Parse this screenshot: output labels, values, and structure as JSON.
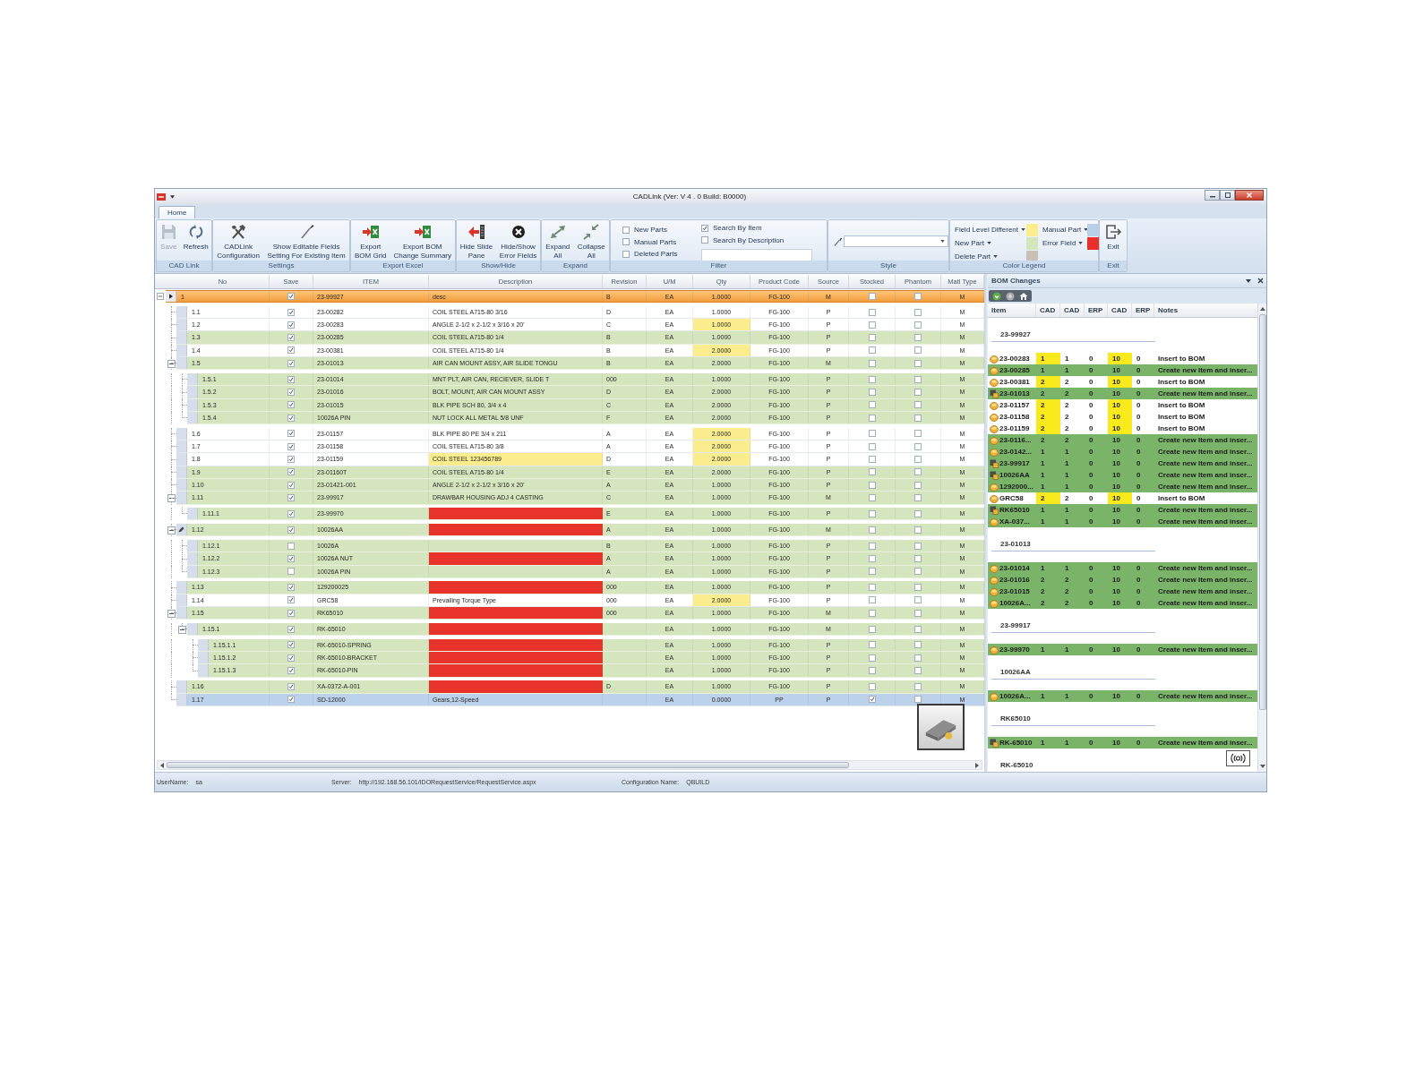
{
  "window": {
    "title": "CADLink (Ver: V 4 . 0 Build: B0000)"
  },
  "ribbon": {
    "tabs": [
      {
        "label": "Home",
        "selected": true
      }
    ],
    "groups": [
      {
        "kind": "buttons",
        "label": "CAD Link",
        "buttons": [
          {
            "label": "Save",
            "disabled": true
          },
          {
            "label": "Refresh",
            "disabled": false
          }
        ]
      },
      {
        "kind": "buttons",
        "label": "Settings",
        "buttons": [
          {
            "label": "CADLink\nConfiguration",
            "disabled": false
          },
          {
            "label": "Show Editable Fields\nSetting For Existing Item",
            "disabled": false
          }
        ]
      },
      {
        "kind": "buttons",
        "label": "Export Excel",
        "buttons": [
          {
            "label": "Export\nBOM Grid",
            "disabled": false
          },
          {
            "label": "Export BOM\nChange Summary",
            "disabled": false
          }
        ]
      },
      {
        "kind": "buttons",
        "label": "Show/Hide",
        "buttons": [
          {
            "label": "Hide Slide\nPane",
            "disabled": false
          },
          {
            "label": "Hide/Show\nError Fields",
            "disabled": false
          }
        ]
      },
      {
        "kind": "buttons",
        "label": "Expand",
        "buttons": [
          {
            "label": "Expand\nAll",
            "disabled": false
          },
          {
            "label": "Collapse\nAll",
            "disabled": false
          }
        ]
      },
      {
        "kind": "filter",
        "label": "Filter",
        "part_filters": [
          {
            "label": "New Parts",
            "checked": false
          },
          {
            "label": "Manual Parts",
            "checked": false
          },
          {
            "label": "Deleted Parts",
            "checked": false
          }
        ],
        "search_modes": [
          {
            "label": "Search By Item",
            "checked": true
          },
          {
            "label": "Search By Description",
            "checked": false
          }
        ]
      },
      {
        "kind": "style",
        "label": "Style"
      },
      {
        "kind": "legend",
        "label": "Color Legend",
        "items": [
          {
            "label": "Field Level Different",
            "color": "#fcee8e"
          },
          {
            "label": "New Part",
            "color": "#d4e6bc"
          },
          {
            "label": "Delete Part",
            "color": "#c8c0b7"
          },
          {
            "label": "Manual Part",
            "color": "#b8cfe7"
          },
          {
            "label": "Error Field",
            "color": "#e8302a"
          }
        ]
      },
      {
        "kind": "buttons",
        "label": "Exit",
        "buttons": [
          {
            "label": "Exit",
            "disabled": false
          }
        ]
      }
    ]
  },
  "grid": {
    "columns": [
      "No",
      "Save",
      "ITEM",
      "Description",
      "Revision",
      "U/M",
      "Qty",
      "Product Code",
      "Source",
      "Stocked",
      "Phantom",
      "Matl Type"
    ],
    "rows": [
      {
        "no": "1",
        "save": true,
        "item": "23-99927",
        "description": "desc",
        "revision": "B",
        "um": "EA",
        "qty": "1.0000",
        "product_code": "FG-100",
        "source": "M",
        "stocked": false,
        "phantom": false,
        "matl_type": "M",
        "selected": true,
        "editing": false,
        "qty_changed": false,
        "description_changed": false,
        "description_error": false,
        "expanded": true,
        "children": [
          {
            "no": "1.1",
            "save": true,
            "item": "23-00282",
            "description": "COIL STEEL A715-80 3/16",
            "revision": "D",
            "um": "EA",
            "qty": "1.0000",
            "product_code": "FG-100",
            "source": "P",
            "stocked": false,
            "phantom": false,
            "matl_type": "M",
            "kind": "existing",
            "selected": false,
            "editing": false,
            "qty_changed": false,
            "description_changed": false,
            "description_error": false
          },
          {
            "no": "1.2",
            "save": true,
            "item": "23-00283",
            "description": "ANGLE 2-1/2 x 2-1/2 x 3/16 x 20'",
            "revision": "C",
            "um": "EA",
            "qty": "1.0000",
            "product_code": "FG-100",
            "source": "P",
            "stocked": false,
            "phantom": false,
            "matl_type": "M",
            "kind": "existing",
            "selected": false,
            "editing": false,
            "qty_changed": true,
            "description_changed": false,
            "description_error": false
          },
          {
            "no": "1.3",
            "save": true,
            "item": "23-00285",
            "description": "COIL STEEL A715-80 1/4",
            "revision": "B",
            "um": "EA",
            "qty": "1.0000",
            "product_code": "FG-100",
            "source": "P",
            "stocked": false,
            "phantom": false,
            "matl_type": "M",
            "kind": "new",
            "selected": false,
            "editing": false,
            "qty_changed": false,
            "description_changed": false,
            "description_error": false
          },
          {
            "no": "1.4",
            "save": true,
            "item": "23-00381",
            "description": "COIL STEEL A715-80 1/4",
            "revision": "B",
            "um": "EA",
            "qty": "2.0000",
            "product_code": "FG-100",
            "source": "P",
            "stocked": false,
            "phantom": false,
            "matl_type": "M",
            "kind": "existing",
            "selected": false,
            "editing": false,
            "qty_changed": true,
            "description_changed": false,
            "description_error": false
          },
          {
            "no": "1.5",
            "save": true,
            "item": "23-01013",
            "description": "AIR CAN MOUNT ASSY, AIR SLIDE TONGU",
            "revision": "B",
            "um": "EA",
            "qty": "2.0000",
            "product_code": "FG-100",
            "source": "M",
            "stocked": false,
            "phantom": false,
            "matl_type": "M",
            "kind": "new",
            "selected": false,
            "editing": false,
            "qty_changed": false,
            "description_changed": false,
            "description_error": false,
            "expanded": true,
            "children": [
              {
                "no": "1.5.1",
                "save": true,
                "item": "23-01014",
                "description": "MNT PLT, AIR CAN, RECIEVER, SLIDE T",
                "revision": "000",
                "um": "EA",
                "qty": "1.0000",
                "product_code": "FG-100",
                "source": "P",
                "stocked": false,
                "phantom": false,
                "matl_type": "M",
                "kind": "new",
                "selected": false,
                "editing": false,
                "qty_changed": false,
                "description_changed": false,
                "description_error": false
              },
              {
                "no": "1.5.2",
                "save": true,
                "item": "23-01016",
                "description": "BOLT, MOUNT, AIR CAN MOUNT ASSY",
                "revision": "D",
                "um": "EA",
                "qty": "2.0000",
                "product_code": "FG-100",
                "source": "P",
                "stocked": false,
                "phantom": false,
                "matl_type": "M",
                "kind": "new",
                "selected": false,
                "editing": false,
                "qty_changed": false,
                "description_changed": false,
                "description_error": false
              },
              {
                "no": "1.5.3",
                "save": true,
                "item": "23-01015",
                "description": "BLK PIPE SCH 80, 3/4 x 4",
                "revision": "C",
                "um": "EA",
                "qty": "2.0000",
                "product_code": "FG-100",
                "source": "P",
                "stocked": false,
                "phantom": false,
                "matl_type": "M",
                "kind": "new",
                "selected": false,
                "editing": false,
                "qty_changed": false,
                "description_changed": false,
                "description_error": false
              },
              {
                "no": "1.5.4",
                "save": true,
                "item": "10026A PIN",
                "description": "NUT LOCK ALL METAL 5/8 UNF",
                "revision": "F",
                "um": "EA",
                "qty": "2.0000",
                "product_code": "FG-100",
                "source": "P",
                "stocked": false,
                "phantom": false,
                "matl_type": "M",
                "kind": "new",
                "selected": false,
                "editing": false,
                "qty_changed": false,
                "description_changed": false,
                "description_error": false
              }
            ]
          },
          {
            "no": "1.6",
            "save": true,
            "item": "23-01157",
            "description": "BLK PIPE 80 PE 3/4 x 211",
            "revision": "A",
            "um": "EA",
            "qty": "2.0000",
            "product_code": "FG-100",
            "source": "P",
            "stocked": false,
            "phantom": false,
            "matl_type": "M",
            "kind": "existing",
            "selected": false,
            "editing": false,
            "qty_changed": true,
            "description_changed": false,
            "description_error": false
          },
          {
            "no": "1.7",
            "save": true,
            "item": "23-01158",
            "description": "COIL STEEL A715-80 3/8",
            "revision": "A",
            "um": "EA",
            "qty": "2.0000",
            "product_code": "FG-100",
            "source": "P",
            "stocked": false,
            "phantom": false,
            "matl_type": "M",
            "kind": "existing",
            "selected": false,
            "editing": false,
            "qty_changed": true,
            "description_changed": false,
            "description_error": false
          },
          {
            "no": "1.8",
            "save": true,
            "item": "23-01159",
            "description": "COIL STEEL 123456789",
            "revision": "D",
            "um": "EA",
            "qty": "2.0000",
            "product_code": "FG-100",
            "source": "P",
            "stocked": false,
            "phantom": false,
            "matl_type": "M",
            "kind": "existing",
            "selected": false,
            "editing": false,
            "qty_changed": true,
            "description_changed": true,
            "description_error": false
          },
          {
            "no": "1.9",
            "save": true,
            "item": "23-01160T",
            "description": "COIL STEEL A715-80 1/4",
            "revision": "E",
            "um": "EA",
            "qty": "2.0000",
            "product_code": "FG-100",
            "source": "P",
            "stocked": false,
            "phantom": false,
            "matl_type": "M",
            "kind": "new",
            "selected": false,
            "editing": false,
            "qty_changed": false,
            "description_changed": false,
            "description_error": false
          },
          {
            "no": "1.10",
            "save": true,
            "item": "23-01421-001",
            "description": "ANGLE 2-1/2 x 2-1/2 x 3/16 x 20'",
            "revision": "A",
            "um": "EA",
            "qty": "1.0000",
            "product_code": "FG-100",
            "source": "P",
            "stocked": false,
            "phantom": false,
            "matl_type": "M",
            "kind": "new",
            "selected": false,
            "editing": false,
            "qty_changed": false,
            "description_changed": false,
            "description_error": false
          },
          {
            "no": "1.11",
            "save": true,
            "item": "23-99917",
            "description": "DRAWBAR HOUSING ADJ 4 CASTING",
            "revision": "C",
            "um": "EA",
            "qty": "1.0000",
            "product_code": "FG-100",
            "source": "M",
            "stocked": false,
            "phantom": false,
            "matl_type": "M",
            "kind": "new",
            "selected": false,
            "editing": false,
            "qty_changed": false,
            "description_changed": false,
            "description_error": false,
            "expanded": true,
            "children": [
              {
                "no": "1.11.1",
                "save": true,
                "item": "23-99970",
                "revision": "E",
                "um": "EA",
                "qty": "1.0000",
                "product_code": "FG-100",
                "source": "P",
                "stocked": false,
                "phantom": false,
                "matl_type": "M",
                "kind": "new",
                "selected": false,
                "editing": false,
                "qty_changed": false,
                "description_changed": false,
                "description_error": true
              }
            ]
          },
          {
            "no": "1.12",
            "save": true,
            "item": "10026AA",
            "revision": "A",
            "um": "EA",
            "qty": "1.0000",
            "product_code": "FG-100",
            "source": "M",
            "stocked": false,
            "phantom": false,
            "matl_type": "M",
            "kind": "new",
            "selected": false,
            "editing": true,
            "qty_changed": false,
            "description_changed": false,
            "description_error": true,
            "expanded": true,
            "children": [
              {
                "no": "1.12.1",
                "save": false,
                "item": "10026A",
                "revision": "B",
                "um": "EA",
                "qty": "1.0000",
                "product_code": "FG-100",
                "source": "P",
                "stocked": false,
                "phantom": false,
                "matl_type": "M",
                "kind": "new",
                "selected": false,
                "editing": false,
                "qty_changed": false,
                "description_changed": false,
                "description_error": false
              },
              {
                "no": "1.12.2",
                "save": true,
                "item": "10026A NUT",
                "revision": "A",
                "um": "EA",
                "qty": "1.0000",
                "product_code": "FG-100",
                "source": "P",
                "stocked": false,
                "phantom": false,
                "matl_type": "M",
                "kind": "new",
                "selected": false,
                "editing": false,
                "qty_changed": false,
                "description_changed": false,
                "description_error": true
              },
              {
                "no": "1.12.3",
                "save": false,
                "item": "10026A PIN",
                "revision": "A",
                "um": "EA",
                "qty": "1.0000",
                "product_code": "FG-100",
                "source": "P",
                "stocked": false,
                "phantom": false,
                "matl_type": "M",
                "kind": "new",
                "selected": false,
                "editing": false,
                "qty_changed": false,
                "description_changed": false,
                "description_error": false
              }
            ]
          },
          {
            "no": "1.13",
            "save": true,
            "item": "129200025",
            "revision": "000",
            "um": "EA",
            "qty": "1.0000",
            "product_code": "FG-100",
            "source": "P",
            "stocked": false,
            "phantom": false,
            "matl_type": "M",
            "kind": "new",
            "selected": false,
            "editing": false,
            "qty_changed": false,
            "description_changed": false,
            "description_error": true
          },
          {
            "no": "1.14",
            "save": true,
            "item": "GRC58",
            "description": "Prevailing Torque Type",
            "revision": "000",
            "um": "EA",
            "qty": "2.0000",
            "product_code": "FG-100",
            "source": "P",
            "stocked": false,
            "phantom": false,
            "matl_type": "M",
            "kind": "existing",
            "selected": false,
            "editing": false,
            "qty_changed": true,
            "description_changed": false,
            "description_error": false
          },
          {
            "no": "1.15",
            "save": true,
            "item": "RK65010",
            "revision": "000",
            "um": "EA",
            "qty": "1.0000",
            "product_code": "FG-100",
            "source": "M",
            "stocked": false,
            "phantom": false,
            "matl_type": "M",
            "kind": "new",
            "selected": false,
            "editing": false,
            "qty_changed": false,
            "description_changed": false,
            "description_error": true,
            "expanded": true,
            "children": [
              {
                "no": "1.15.1",
                "save": true,
                "item": "RK-65010",
                "um": "EA",
                "qty": "1.0000",
                "product_code": "FG-100",
                "source": "M",
                "stocked": false,
                "phantom": false,
                "matl_type": "M",
                "kind": "new",
                "selected": false,
                "editing": false,
                "qty_changed": false,
                "description_changed": false,
                "description_error": true,
                "expanded": true,
                "children": [
                  {
                    "no": "1.15.1.1",
                    "save": true,
                    "item": "RK-65010-SPRING",
                    "um": "EA",
                    "qty": "1.0000",
                    "product_code": "FG-100",
                    "source": "P",
                    "stocked": false,
                    "phantom": false,
                    "matl_type": "M",
                    "kind": "new",
                    "selected": false,
                    "editing": false,
                    "qty_changed": false,
                    "description_changed": false,
                    "description_error": true
                  },
                  {
                    "no": "1.15.1.2",
                    "save": true,
                    "item": "RK-65010-BRACKET",
                    "um": "EA",
                    "qty": "1.0000",
                    "product_code": "FG-100",
                    "source": "P",
                    "stocked": false,
                    "phantom": false,
                    "matl_type": "M",
                    "kind": "new",
                    "selected": false,
                    "editing": false,
                    "qty_changed": false,
                    "description_changed": false,
                    "description_error": true
                  },
                  {
                    "no": "1.15.1.3",
                    "save": true,
                    "item": "RK-65010-PIN",
                    "um": "EA",
                    "qty": "1.0000",
                    "product_code": "FG-100",
                    "source": "P",
                    "stocked": false,
                    "phantom": false,
                    "matl_type": "M",
                    "kind": "new",
                    "selected": false,
                    "editing": false,
                    "qty_changed": false,
                    "description_changed": false,
                    "description_error": true
                  }
                ]
              }
            ]
          },
          {
            "no": "1.16",
            "save": true,
            "item": "XA-0372-A-001",
            "revision": "D",
            "um": "EA",
            "qty": "1.0000",
            "product_code": "FG-100",
            "source": "P",
            "stocked": false,
            "phantom": false,
            "matl_type": "M",
            "kind": "new",
            "selected": false,
            "editing": false,
            "qty_changed": false,
            "description_changed": false,
            "description_error": true
          },
          {
            "no": "1.17",
            "save": true,
            "item": "SD-12000",
            "description": "Gears,12-Speed",
            "um": "EA",
            "qty": "0.0000",
            "product_code": "PP",
            "source": "P",
            "stocked": true,
            "phantom": false,
            "matl_type": "M",
            "kind": "manual",
            "selected": false,
            "editing": false,
            "qty_changed": false,
            "description_changed": false,
            "description_error": false
          }
        ]
      }
    ]
  },
  "bom_changes": {
    "title": "BOM Changes",
    "columns": [
      "Item",
      "CAD",
      "CAD",
      "ERP",
      "CAD",
      "ERP",
      "Notes"
    ],
    "groups": [
      {
        "title": "23-99927",
        "rows": [
          {
            "item": "23-00283",
            "kind": "part",
            "quantities": [
              "1",
              "1",
              "0",
              "10",
              "0"
            ],
            "notes": "Insert to BOM",
            "new_item": false,
            "changed": true
          },
          {
            "item": "23-00285",
            "kind": "part",
            "quantities": [
              "1",
              "1",
              "0",
              "10",
              "0"
            ],
            "notes": "Create new Item and inser...",
            "new_item": true,
            "changed": false
          },
          {
            "item": "23-00381",
            "kind": "part",
            "quantities": [
              "2",
              "2",
              "0",
              "10",
              "0"
            ],
            "notes": "Insert to BOM",
            "new_item": false,
            "changed": true
          },
          {
            "item": "23-01013",
            "kind": "assembly",
            "quantities": [
              "2",
              "2",
              "0",
              "10",
              "0"
            ],
            "notes": "Create new Item and inser...",
            "new_item": true,
            "changed": false
          },
          {
            "item": "23-01157",
            "kind": "part",
            "quantities": [
              "2",
              "2",
              "0",
              "10",
              "0"
            ],
            "notes": "Insert to BOM",
            "new_item": false,
            "changed": true
          },
          {
            "item": "23-01158",
            "kind": "part",
            "quantities": [
              "2",
              "2",
              "0",
              "10",
              "0"
            ],
            "notes": "Insert to BOM",
            "new_item": false,
            "changed": true
          },
          {
            "item": "23-01159",
            "kind": "part",
            "quantities": [
              "2",
              "2",
              "0",
              "10",
              "0"
            ],
            "notes": "Insert to BOM",
            "new_item": false,
            "changed": true
          },
          {
            "item": "23-0116...",
            "kind": "part",
            "quantities": [
              "2",
              "2",
              "0",
              "10",
              "0"
            ],
            "notes": "Create new Item and inser...",
            "new_item": true,
            "changed": false
          },
          {
            "item": "23-0142...",
            "kind": "part",
            "quantities": [
              "1",
              "1",
              "0",
              "10",
              "0"
            ],
            "notes": "Create new Item and inser...",
            "new_item": true,
            "changed": false
          },
          {
            "item": "23-99917",
            "kind": "assembly",
            "quantities": [
              "1",
              "1",
              "0",
              "10",
              "0"
            ],
            "notes": "Create new Item and inser...",
            "new_item": true,
            "changed": false
          },
          {
            "item": "10026AA",
            "kind": "assembly",
            "quantities": [
              "1",
              "1",
              "0",
              "10",
              "0"
            ],
            "notes": "Create new Item and inser...",
            "new_item": true,
            "changed": false
          },
          {
            "item": "1292000...",
            "kind": "part",
            "quantities": [
              "1",
              "1",
              "0",
              "10",
              "0"
            ],
            "notes": "Create new Item and inser...",
            "new_item": true,
            "changed": false
          },
          {
            "item": "GRC58",
            "kind": "part",
            "quantities": [
              "2",
              "2",
              "0",
              "10",
              "0"
            ],
            "notes": "Insert to BOM",
            "new_item": false,
            "changed": true
          },
          {
            "item": "RK65010",
            "kind": "assembly",
            "quantities": [
              "1",
              "1",
              "0",
              "10",
              "0"
            ],
            "notes": "Create new Item and inser...",
            "new_item": true,
            "changed": false
          },
          {
            "item": "XA-037...",
            "kind": "part",
            "quantities": [
              "1",
              "1",
              "0",
              "10",
              "0"
            ],
            "notes": "Create new Item and inser...",
            "new_item": true,
            "changed": false
          }
        ]
      },
      {
        "title": "23-01013",
        "rows": [
          {
            "item": "23-01014",
            "kind": "part",
            "quantities": [
              "1",
              "1",
              "0",
              "10",
              "0"
            ],
            "notes": "Create new Item and inser...",
            "new_item": true,
            "changed": false
          },
          {
            "item": "23-01016",
            "kind": "part",
            "quantities": [
              "2",
              "2",
              "0",
              "10",
              "0"
            ],
            "notes": "Create new Item and inser...",
            "new_item": true,
            "changed": false
          },
          {
            "item": "23-01015",
            "kind": "part",
            "quantities": [
              "2",
              "2",
              "0",
              "10",
              "0"
            ],
            "notes": "Create new Item and inser...",
            "new_item": true,
            "changed": false
          },
          {
            "item": "10026A...",
            "kind": "part",
            "quantities": [
              "2",
              "2",
              "0",
              "10",
              "0"
            ],
            "notes": "Create new Item and inser...",
            "new_item": true,
            "changed": false
          }
        ]
      },
      {
        "title": "23-99917",
        "rows": [
          {
            "item": "23-99970",
            "kind": "part",
            "quantities": [
              "1",
              "1",
              "0",
              "10",
              "0"
            ],
            "notes": "Create new Item and inser...",
            "new_item": true,
            "changed": false
          }
        ]
      },
      {
        "title": "10026AA",
        "rows": [
          {
            "item": "10026A...",
            "kind": "part",
            "quantities": [
              "1",
              "1",
              "0",
              "10",
              "0"
            ],
            "notes": "Create new Item and inser...",
            "new_item": true,
            "changed": false
          }
        ]
      },
      {
        "title": "RK65010",
        "rows": [
          {
            "item": "RK-65010",
            "kind": "assembly",
            "quantities": [
              "1",
              "1",
              "0",
              "10",
              "0"
            ],
            "notes": "Create new Item and inser...",
            "new_item": true,
            "changed": false
          }
        ]
      },
      {
        "title": "RK-65010"
      }
    ]
  },
  "status_bar": {
    "fields": [
      {
        "label": "UserName:",
        "value": "sa"
      },
      {
        "label": "Server:",
        "value": "http://192.168.56.101/IDORequestService/RequestService.aspx"
      },
      {
        "label": "Configuration Name:",
        "value": "QBUILD"
      }
    ]
  }
}
